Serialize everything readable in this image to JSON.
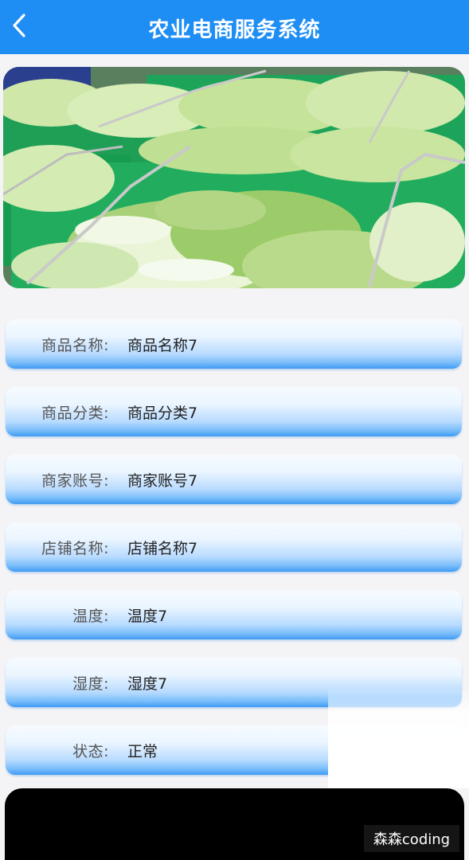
{
  "header": {
    "title": "农业电商服务系统",
    "back_icon": "chevron-left-icon"
  },
  "hero": {
    "image": "chinese-cabbage-crates-photo"
  },
  "fields": [
    {
      "label": "商品名称:",
      "value": "商品名称7"
    },
    {
      "label": "商品分类:",
      "value": "商品分类7"
    },
    {
      "label": "商家账号:",
      "value": "商家账号7"
    },
    {
      "label": "店铺名称:",
      "value": "店铺名称7"
    },
    {
      "label": "温度:",
      "value": "温度7"
    },
    {
      "label": "湿度:",
      "value": "湿度7"
    },
    {
      "label": "状态:",
      "value": "正常"
    }
  ],
  "watermark": "森森coding",
  "colors": {
    "header": "#1e8ef5",
    "field_gradient_end": "#3f9bf3"
  }
}
